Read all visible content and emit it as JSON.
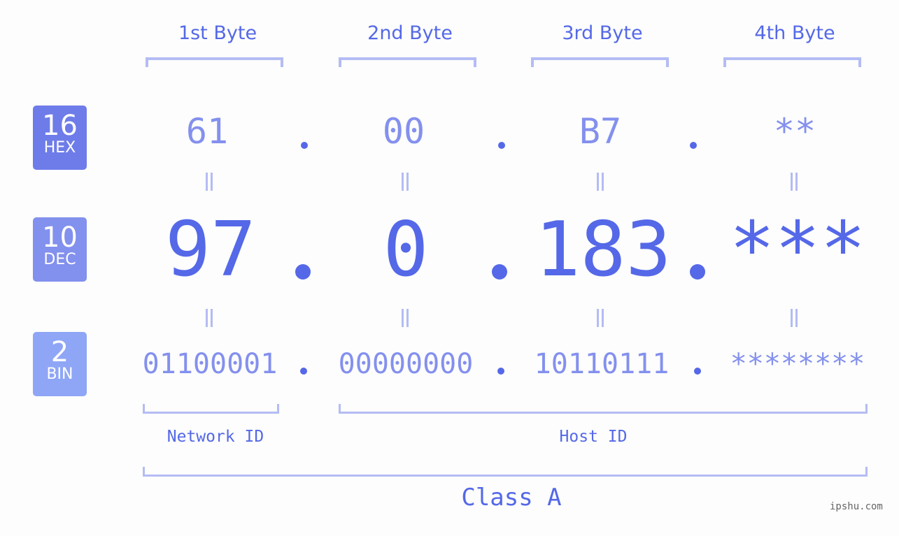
{
  "headers": [
    "1st Byte",
    "2nd Byte",
    "3rd Byte",
    "4th Byte"
  ],
  "badges": [
    {
      "number": "16",
      "label": "HEX",
      "color": "#6e7ce9"
    },
    {
      "number": "10",
      "label": "DEC",
      "color": "#8290ee"
    },
    {
      "number": "2",
      "label": "BIN",
      "color": "#8fa6f6"
    }
  ],
  "hex": [
    "61",
    "00",
    "B7",
    "**"
  ],
  "dec": [
    "97",
    "0",
    "183",
    "***"
  ],
  "bin": [
    "01100001",
    "00000000",
    "10110111",
    "********"
  ],
  "network_label": "Network ID",
  "host_label": "Host ID",
  "class_label": "Class A",
  "watermark": "ipshu.com"
}
